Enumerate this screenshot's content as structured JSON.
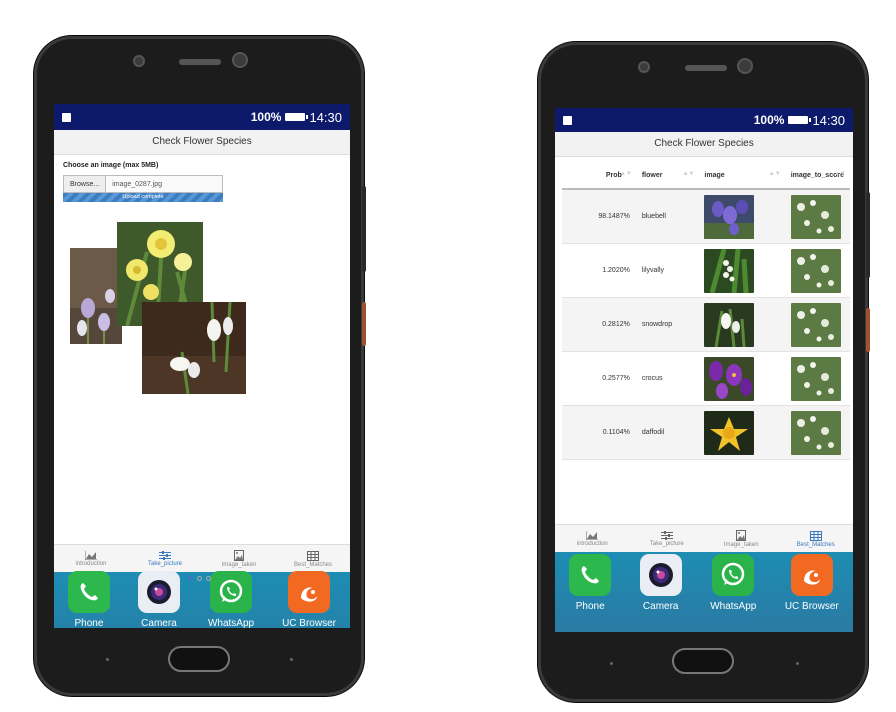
{
  "left_phone": {
    "status": {
      "battery": "100%",
      "time": "14:30"
    },
    "app_title": "Check Flower Species",
    "upload": {
      "label": "Choose an image (max 5MB)",
      "browse_label": "Browse...",
      "file_name": "image_0287.jpg",
      "progress_text": "Upload complete",
      "progress": 1.0
    },
    "tabs": [
      {
        "label": "introduction",
        "icon": "area-chart-icon"
      },
      {
        "label": "Take_picture",
        "icon": "sliders-icon"
      },
      {
        "label": "Image_taken",
        "icon": "image-file-icon"
      },
      {
        "label": "Best_Matches",
        "icon": "table-grid-icon"
      }
    ],
    "active_tab": "Take_picture",
    "dock": [
      {
        "label": "Phone",
        "icon": "phone-icon",
        "color": "#2db84d"
      },
      {
        "label": "Camera",
        "icon": "camera-icon",
        "color": "#e9eef5"
      },
      {
        "label": "WhatsApp",
        "icon": "whatsapp-icon",
        "color": "#29b34a"
      },
      {
        "label": "UC Browser",
        "icon": "uc-browser-icon",
        "color": "#f26a21"
      }
    ]
  },
  "right_phone": {
    "status": {
      "battery": "100%",
      "time": "14:30"
    },
    "app_title": "Check Flower Species",
    "table": {
      "headers": [
        "Prob",
        "flower",
        "image",
        "image_to_score"
      ],
      "rows": [
        {
          "prob": "98.1487%",
          "flower": "bluebell",
          "image": "bluebell-thumb"
        },
        {
          "prob": "1.2020%",
          "flower": "lilyvally",
          "image": "lilyvally-thumb"
        },
        {
          "prob": "0.2812%",
          "flower": "snowdrop",
          "image": "snowdrop-thumb"
        },
        {
          "prob": "0.2577%",
          "flower": "crocus",
          "image": "crocus-thumb"
        },
        {
          "prob": "0.1104%",
          "flower": "daffodil",
          "image": "daffodil-thumb"
        }
      ]
    },
    "tabs": [
      {
        "label": "introduction",
        "icon": "area-chart-icon"
      },
      {
        "label": "Take_picture",
        "icon": "sliders-icon"
      },
      {
        "label": "Image_taken",
        "icon": "image-file-icon"
      },
      {
        "label": "Best_Matches",
        "icon": "table-grid-icon"
      }
    ],
    "active_tab": "Best_Matches",
    "dock": [
      {
        "label": "Phone",
        "icon": "phone-icon",
        "color": "#2db84d"
      },
      {
        "label": "Camera",
        "icon": "camera-icon",
        "color": "#e9eef5"
      },
      {
        "label": "WhatsApp",
        "icon": "whatsapp-icon",
        "color": "#29b34a"
      },
      {
        "label": "UC Browser",
        "icon": "uc-browser-icon",
        "color": "#f26a21"
      }
    ]
  }
}
